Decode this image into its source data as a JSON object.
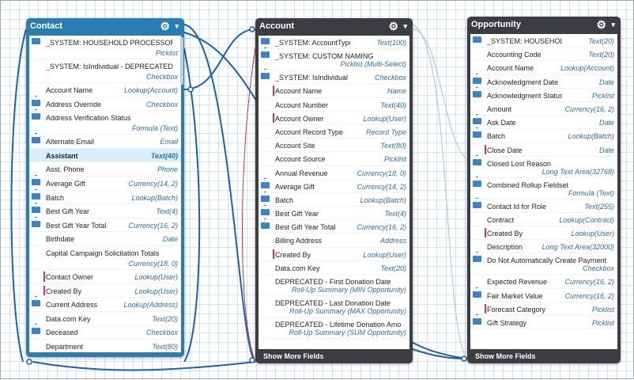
{
  "colors": {
    "contact_header": "#2a7db1",
    "dark_header": "#3b3d41",
    "type_text": "#2a6bb0",
    "lookup_marker": "#d0394a",
    "highlight_row": "#d8eefa"
  },
  "contact": {
    "title": "Contact",
    "gear": "⚙",
    "caret": "▾",
    "fields": [
      {
        "name": "_SYSTEM: HOUSEHOLD PROCESSOR",
        "type": "Picklist",
        "icon": true,
        "two": true
      },
      {
        "name": "_SYSTEM: IsIndividual - DEPRECATED",
        "type": "Checkbox",
        "icon": false,
        "two": true
      },
      {
        "name": "Account Name",
        "type": "Lookup(Account)",
        "icon": false
      },
      {
        "name": "Address Override",
        "type": "Checkbox",
        "icon": true
      },
      {
        "name": "Address Verification Status",
        "type": "Formula (Text)",
        "icon": true,
        "two": true
      },
      {
        "name": "Alternate Email",
        "type": "Email",
        "icon": true
      },
      {
        "name": "Assistant",
        "type": "Text(40)",
        "icon": false,
        "hl": true
      },
      {
        "name": "Asst. Phone",
        "type": "Phone",
        "icon": false
      },
      {
        "name": "Average Gift",
        "type": "Currency(14, 2)",
        "icon": true
      },
      {
        "name": "Batch",
        "type": "Lookup(Batch)",
        "icon": true
      },
      {
        "name": "Best Gift Year",
        "type": "Text(4)",
        "icon": true
      },
      {
        "name": "Best Gift Year Total",
        "type": "Currency(16, 2)",
        "icon": true
      },
      {
        "name": "Birthdate",
        "type": "Date",
        "icon": false
      },
      {
        "name": "Capital Campaign Solicitation Totals",
        "type": "Currency(18, 0)",
        "icon": false,
        "two": true
      },
      {
        "name": "Contact Owner",
        "type": "Lookup(User)",
        "icon": false,
        "link": true
      },
      {
        "name": "Created By",
        "type": "Lookup(User)",
        "icon": false,
        "link": true
      },
      {
        "name": "Current Address",
        "type": "Lookup(Address)",
        "icon": true
      },
      {
        "name": "Data.com Key",
        "type": "Text(20)",
        "icon": false
      },
      {
        "name": "Deceased",
        "type": "Checkbox",
        "icon": true
      },
      {
        "name": "Department",
        "type": "Text(80)",
        "icon": false
      }
    ]
  },
  "account": {
    "title": "Account",
    "gear": "⚙",
    "caret": "▾",
    "footer": "Show More Fields",
    "fields": [
      {
        "name": "_SYSTEM: AccountType",
        "type": "Text(100)",
        "icon": true
      },
      {
        "name": "_SYSTEM: CUSTOM NAMING",
        "type": "Picklist (Multi-Select)",
        "icon": true,
        "two": true
      },
      {
        "name": "_SYSTEM: IsIndividual",
        "type": "Checkbox",
        "icon": true
      },
      {
        "name": "Account Name",
        "type": "Name",
        "icon": false,
        "link": true
      },
      {
        "name": "Account Number",
        "type": "Text(40)",
        "icon": false
      },
      {
        "name": "Account Owner",
        "type": "Lookup(User)",
        "icon": false,
        "link": true
      },
      {
        "name": "Account Record Type",
        "type": "Record Type",
        "icon": false
      },
      {
        "name": "Account Site",
        "type": "Text(80)",
        "icon": false
      },
      {
        "name": "Account Source",
        "type": "Picklist",
        "icon": false
      },
      {
        "name": "Annual Revenue",
        "type": "Currency(18, 0)",
        "icon": false
      },
      {
        "name": "Average Gift",
        "type": "Currency(14, 2)",
        "icon": true
      },
      {
        "name": "Batch",
        "type": "Lookup(Batch)",
        "icon": true
      },
      {
        "name": "Best Gift Year",
        "type": "Text(4)",
        "icon": true
      },
      {
        "name": "Best Gift Year Total",
        "type": "Currency(16, 2)",
        "icon": true
      },
      {
        "name": "Billing Address",
        "type": "Address",
        "icon": false
      },
      {
        "name": "Created By",
        "type": "Lookup(User)",
        "icon": false,
        "link": true
      },
      {
        "name": "Data.com Key",
        "type": "Text(20)",
        "icon": false
      },
      {
        "name": "DEPRECATED - First Donation Date",
        "type": "Roll-Up Summary (MIN Opportunity)",
        "icon": false,
        "two": true
      },
      {
        "name": "DEPRECATED - Last Donation Date",
        "type": "Roll-Up Summary (MAX Opportunity)",
        "icon": false,
        "two": true
      },
      {
        "name": "DEPRECATED - Lifetime Donation Amount",
        "type": "Roll-Up Summary (SUM Opportunity)",
        "icon": false,
        "two": true
      }
    ]
  },
  "opportunity": {
    "title": "Opportunity",
    "gear": "⚙",
    "caret": "▾",
    "footer": "Show More Fields",
    "fields": [
      {
        "name": "_SYSTEM: HOUSEHOLD CONTACT ROLES",
        "type": "Text(20)",
        "icon": true,
        "one_top": true
      },
      {
        "name": "Accounting Code",
        "type": "Text(20)",
        "icon": false
      },
      {
        "name": "Account Name",
        "type": "Lookup(Account)",
        "icon": false
      },
      {
        "name": "Acknowledgment Date",
        "type": "Date",
        "icon": true
      },
      {
        "name": "Acknowledgment Status",
        "type": "Picklist",
        "icon": true
      },
      {
        "name": "Amount",
        "type": "Currency(16, 2)",
        "icon": false
      },
      {
        "name": "Ask Date",
        "type": "Date",
        "icon": true
      },
      {
        "name": "Batch",
        "type": "Lookup(Batch)",
        "icon": true
      },
      {
        "name": "Close Date",
        "type": "Date",
        "icon": false,
        "link": true
      },
      {
        "name": "Closed Lost Reason",
        "type": "Long Text Area(32768)",
        "icon": true,
        "two": true
      },
      {
        "name": "Combined Rollup Fieldset",
        "type": "Formula (Text)",
        "icon": true,
        "two": true
      },
      {
        "name": "Contact Id for Role",
        "type": "Text(255)",
        "icon": true
      },
      {
        "name": "Contract",
        "type": "Lookup(Contract)",
        "icon": false
      },
      {
        "name": "Created By",
        "type": "Lookup(User)",
        "icon": false,
        "link": true
      },
      {
        "name": "Description",
        "type": "Long Text Area(32000)",
        "icon": false
      },
      {
        "name": "Do Not Automatically Create Payment",
        "type": "Checkbox",
        "icon": true,
        "two": true
      },
      {
        "name": "Expected Revenue",
        "type": "Currency(16, 2)",
        "icon": false
      },
      {
        "name": "Fair Market Value",
        "type": "Currency(16, 2)",
        "icon": true
      },
      {
        "name": "Forecast Category",
        "type": "Picklist",
        "icon": false,
        "link": true
      },
      {
        "name": "Gift Strategy",
        "type": "Picklist",
        "icon": true
      }
    ]
  }
}
